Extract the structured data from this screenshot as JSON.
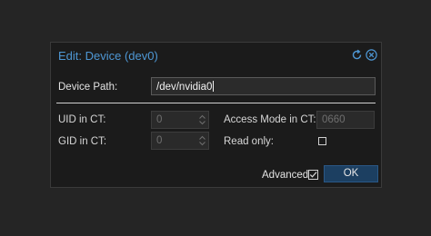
{
  "dialog": {
    "title": "Edit: Device (dev0)",
    "icons": {
      "reset": "reset-icon",
      "close": "close-icon"
    }
  },
  "fields": {
    "device_path": {
      "label": "Device Path:",
      "value": "/dev/nvidia0"
    },
    "uid": {
      "label": "UID in CT:",
      "value": "0"
    },
    "gid": {
      "label": "GID in CT:",
      "value": "0"
    },
    "access_mode": {
      "label": "Access Mode in CT:",
      "value": "0660"
    },
    "read_only": {
      "label": "Read only:",
      "checked": false
    }
  },
  "footer": {
    "advanced_label": "Advanced",
    "advanced_checked": true,
    "ok_label": "OK"
  },
  "colors": {
    "title": "#4e97d4",
    "ok_button": "#1c3f61",
    "dialog_bg": "#1b1b1b",
    "page_bg": "#252525"
  }
}
